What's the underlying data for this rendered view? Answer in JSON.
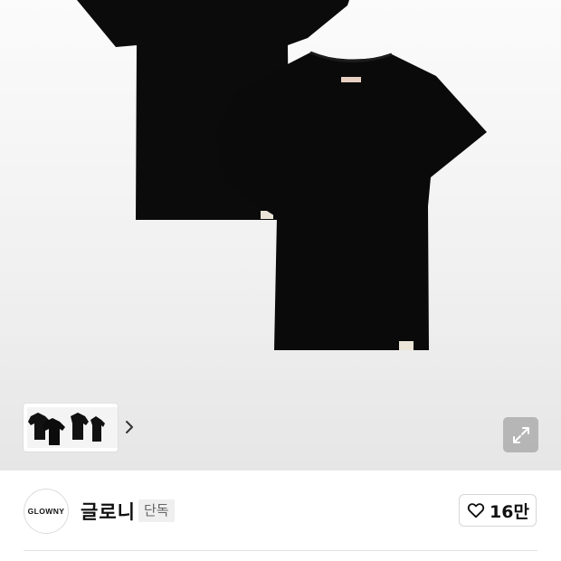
{
  "product_image": {
    "thumbnails": [
      {
        "alt_icon": "tshirt-thumbnail"
      },
      {
        "alt_icon": "tshirt-thumbnail"
      },
      {
        "alt_icon": "tshirt-thumbnail"
      }
    ],
    "expand_icon": "expand-arrows-icon",
    "next_icon": "chevron-right-icon"
  },
  "shop": {
    "logo_text": "GLOWNY",
    "name": "글로니",
    "badge": "단독",
    "likes": "16만",
    "like_icon": "heart-outline-icon"
  }
}
